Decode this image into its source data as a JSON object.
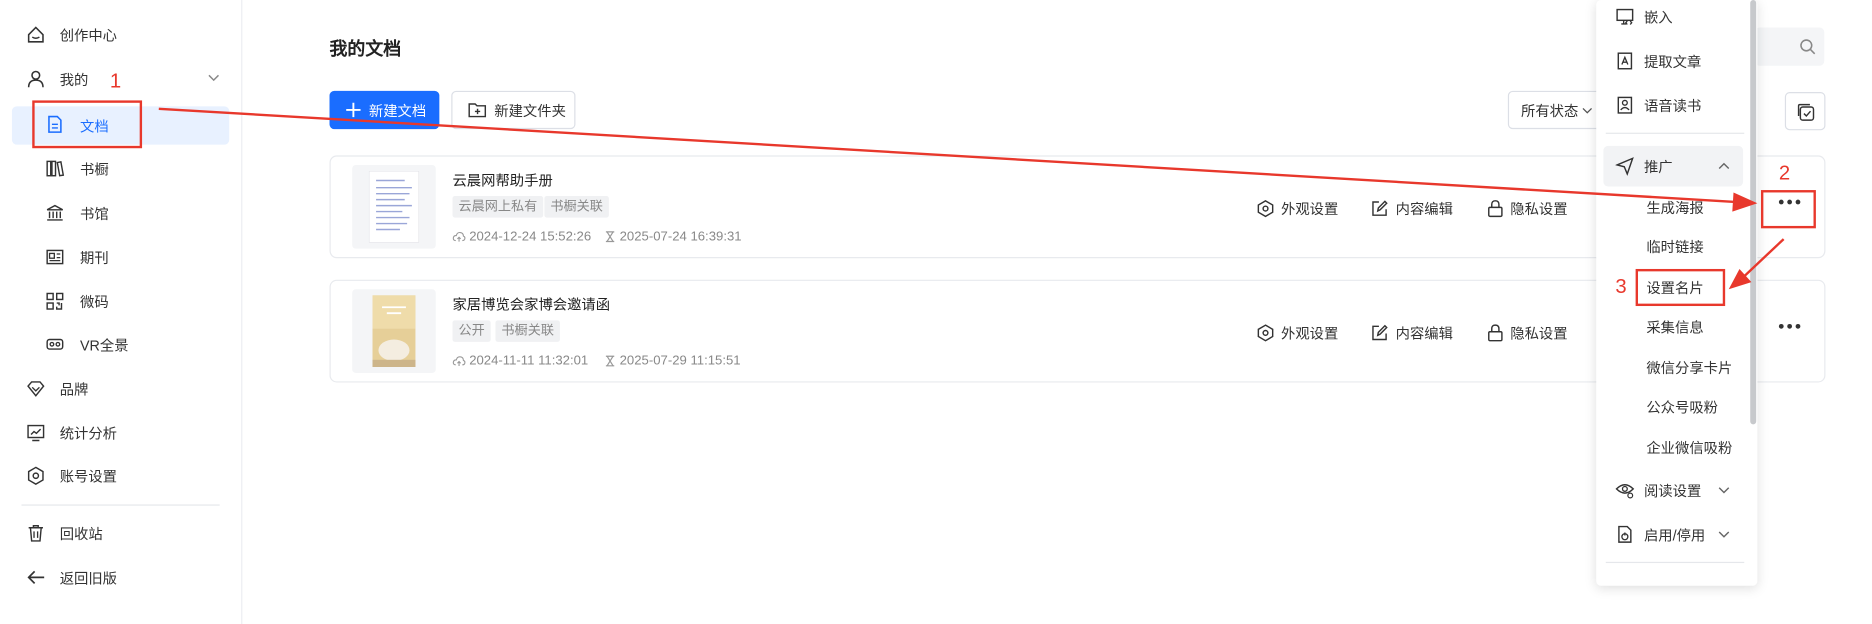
{
  "sidebar": {
    "items": [
      {
        "label": "创作中心",
        "icon": "home-icon"
      },
      {
        "label": "我的",
        "icon": "user-icon"
      },
      {
        "label": "文档",
        "icon": "document-icon"
      },
      {
        "label": "书橱",
        "icon": "bookshelf-icon"
      },
      {
        "label": "书馆",
        "icon": "library-icon"
      },
      {
        "label": "期刊",
        "icon": "journal-icon"
      },
      {
        "label": "微码",
        "icon": "qrcode-icon"
      },
      {
        "label": "VR全景",
        "icon": "vr-icon"
      },
      {
        "label": "品牌",
        "icon": "diamond-icon"
      },
      {
        "label": "统计分析",
        "icon": "chart-icon"
      },
      {
        "label": "账号设置",
        "icon": "settings-icon"
      },
      {
        "label": "回收站",
        "icon": "trash-icon"
      },
      {
        "label": "返回旧版",
        "icon": "arrow-left-icon"
      }
    ]
  },
  "main": {
    "title": "我的文档",
    "new_doc": "新建文档",
    "new_folder": "新建文件夹",
    "filter_status": "所有状态"
  },
  "documents": [
    {
      "title": "云晨网帮助手册",
      "tags": [
        "云晨网上私有",
        "书橱关联"
      ],
      "created": "2024-12-24 15:52:26",
      "updated": "2025-07-24 16:39:31"
    },
    {
      "title": "家居博览会家博会邀请函",
      "tags": [
        "公开",
        "书橱关联"
      ],
      "created": "2024-11-11 11:32:01",
      "updated": "2025-07-29 11:15:51"
    }
  ],
  "actions": {
    "appearance": "外观设置",
    "edit": "内容编辑",
    "privacy": "隐私设置"
  },
  "dropdown": {
    "embed": "嵌入",
    "extract": "提取文章",
    "voice": "语音读书",
    "promote": "推广",
    "poster": "生成海报",
    "temp_link": "临时链接",
    "card": "设置名片",
    "collect": "采集信息",
    "wechat_card": "微信分享卡片",
    "official_account": "公众号吸粉",
    "enterprise_wechat": "企业微信吸粉",
    "read_settings": "阅读设置",
    "enable_disable": "启用/停用"
  },
  "annotations": [
    "1",
    "2",
    "3"
  ],
  "colors": {
    "primary": "#1a6dff",
    "annotation": "#e8382c",
    "active_bg": "#e8f1ff"
  }
}
